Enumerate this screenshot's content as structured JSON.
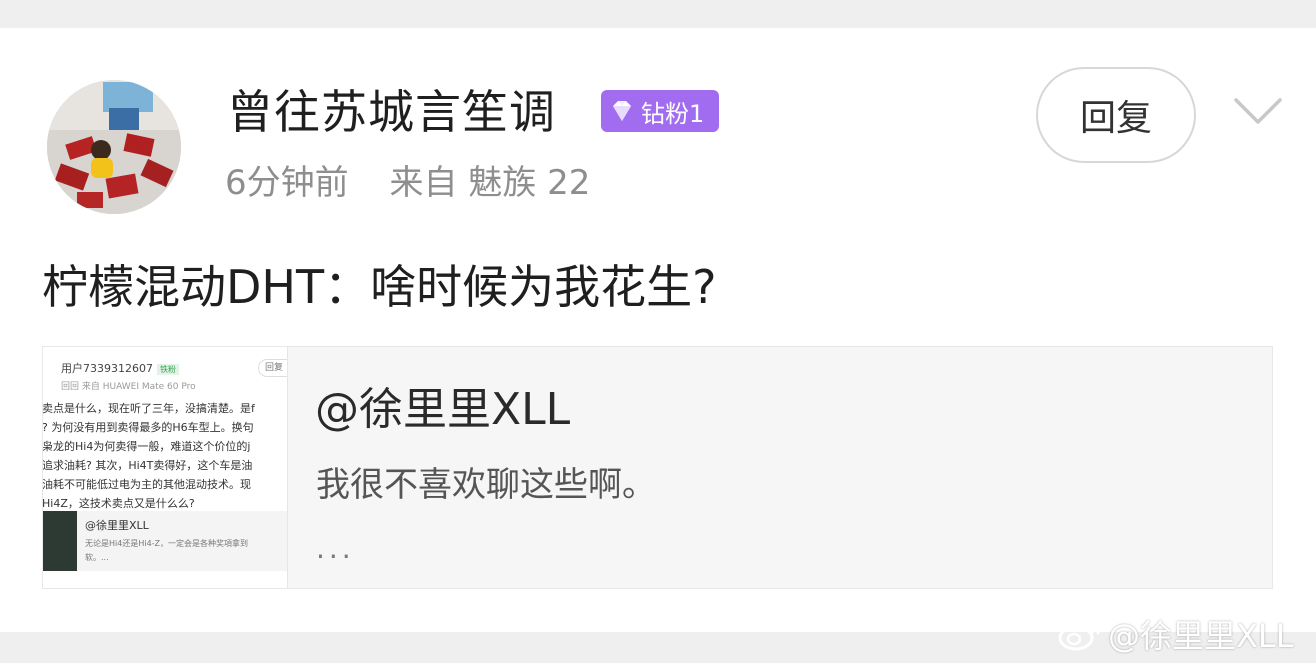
{
  "post": {
    "username": "曾往苏城言笙调",
    "badge_label": "钻粉1",
    "time": "6分钟前",
    "source": "来自 魅族 22",
    "reply_label": "回复",
    "text": "柠檬混动DHT：啥时候为我花生?"
  },
  "quote": {
    "author": "@徐里里XLL",
    "text": "我很不喜欢聊这些啊。",
    "more": "...",
    "thumbnail": {
      "user": "用户7339312607",
      "user_tag": "铁粉",
      "meta": "回回  来自 HUAWEI Mate 60 Pro",
      "reply": "回复",
      "lines": [
        "卖点是什么，现在听了三年，没搞清楚。是f",
        "? 为何没有用到卖得最多的H6车型上。换句",
        "枭龙的Hi4为何卖得一般，难道这个价位的j",
        "追求油耗? 其次，Hi4T卖得好，这个车是油",
        "油耗不可能低过电为主的其他混动技术。现",
        "Hi4Z，这技术卖点又是什么么?"
      ],
      "inner_author": "@徐里里XLL",
      "inner_lines": [
        "无论是Hi4还是Hi4-Z，一定会是各种奖項拿到",
        "软。..."
      ]
    }
  },
  "watermark": {
    "text": "@徐里里XLL",
    "icon": "weibo-icon"
  },
  "colors": {
    "badge": "#a26cf0",
    "card_background": "#ffffff",
    "page_background": "#efefef",
    "quote_background": "#f6f6f6",
    "meta_text": "#8e8e8e"
  }
}
